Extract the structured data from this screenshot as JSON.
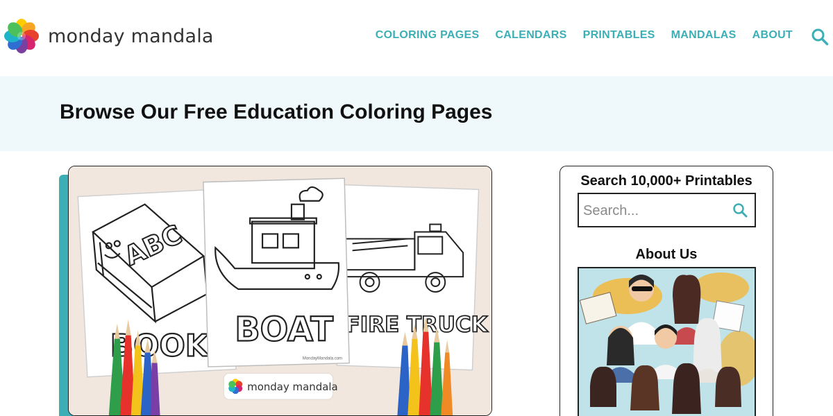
{
  "header": {
    "brand": "monday mandala",
    "nav": [
      {
        "label": "COLORING PAGES"
      },
      {
        "label": "CALENDARS"
      },
      {
        "label": "PRINTABLES"
      },
      {
        "label": "MANDALAS"
      },
      {
        "label": "ABOUT"
      }
    ],
    "accent_color": "#3bafb5"
  },
  "title_band": {
    "title": "Browse Our Free Education Coloring Pages",
    "background": "#eff8fb"
  },
  "featured": {
    "pages": [
      {
        "heading": "ABC",
        "caption": "BOOK"
      },
      {
        "caption": "BOAT"
      },
      {
        "caption": "FIRE TRUCK"
      }
    ],
    "watermark": "MondayMandala.com",
    "badge_text": "monday mandala"
  },
  "sidebar": {
    "search_heading": "Search 10,000+ Printables",
    "search_placeholder": "Search...",
    "about_heading": "About Us"
  },
  "icons": {
    "header_search": "search-icon",
    "sidebar_search": "search-icon",
    "logo": "flower-logo-icon"
  }
}
